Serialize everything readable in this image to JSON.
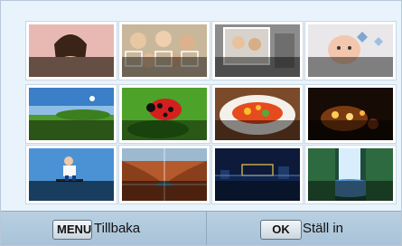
{
  "thumbnails": [
    {
      "name": "portrait-woman-thumb"
    },
    {
      "name": "group-people-thumb"
    },
    {
      "name": "family-photo-thumb"
    },
    {
      "name": "baby-thumb"
    },
    {
      "name": "green-field-landscape-thumb"
    },
    {
      "name": "ladybug-thumb"
    },
    {
      "name": "food-plate-thumb"
    },
    {
      "name": "candle-light-thumb"
    },
    {
      "name": "skateboard-jump-thumb"
    },
    {
      "name": "canyon-thumb"
    },
    {
      "name": "night-skyline-thumb"
    },
    {
      "name": "waterfall-thumb"
    }
  ],
  "footer": {
    "back_key": "MENU",
    "back_label": "Tillbaka",
    "set_key": "OK",
    "set_label": "Ställ in"
  }
}
